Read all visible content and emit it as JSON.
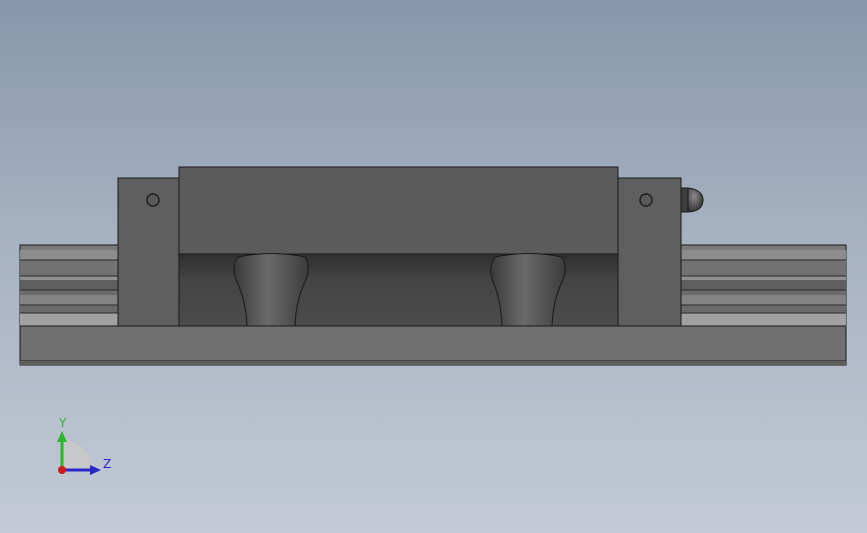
{
  "viewport": {
    "background_top": "#8797ab",
    "background_bottom": "#c3cad6"
  },
  "model": {
    "colors": {
      "rail": "#7a7a7a",
      "rail_dark": "#5e5e5e",
      "rail_light": "#9a9a9a",
      "block": "#5a5a5a",
      "end_cap": "#5f5f5f",
      "cavity": "#464646",
      "outline": "#1a1a1a"
    },
    "grease_nipple_icon": "grease-nipple-icon",
    "mounting_hole_icon": "mounting-hole-icon"
  },
  "triad": {
    "y_label": "Y",
    "z_label": "Z",
    "y_color": "#2db52d",
    "z_color": "#2828c8",
    "x_color": "#d01818"
  }
}
